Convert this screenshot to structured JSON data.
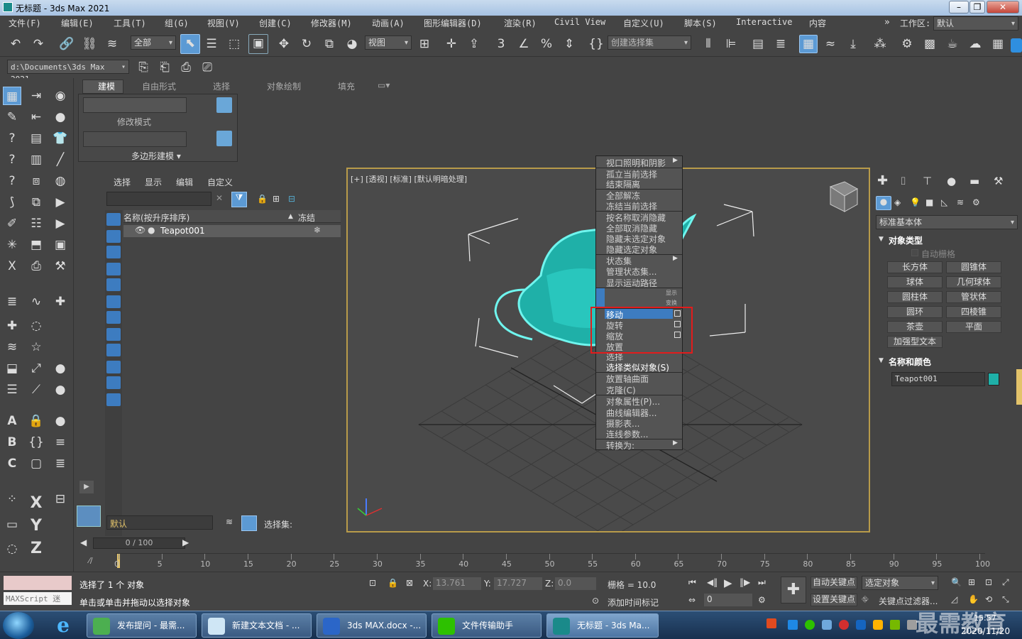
{
  "window": {
    "title": "无标题 - 3ds Max 2021",
    "buttons": [
      "–",
      "❐",
      "✕"
    ]
  },
  "menubar": {
    "items": [
      "文件(F)",
      "编辑(E)",
      "工具(T)",
      "组(G)",
      "视图(V)",
      "创建(C)",
      "修改器(M)",
      "动画(A)",
      "图形编辑器(D)",
      "渲染(R)",
      "Civil View",
      "自定义(U)",
      "脚本(S)",
      "Interactive",
      "内容"
    ],
    "workspace_label": "工作区:",
    "workspace_value": "默认"
  },
  "toolbar": {
    "filter_value": "全部",
    "refcoord_value": "视图",
    "selection_set_placeholder": "创建选择集",
    "path_value": "d:\\Documents\\3ds Max 2021"
  },
  "ribbon": {
    "tabs": [
      "建模",
      "自由形式",
      "选择",
      "对象绘制",
      "填充"
    ],
    "modify_mode": "修改模式",
    "poly_modeling": "多边形建模 ▾"
  },
  "scene_explorer": {
    "tabs": [
      "选择",
      "显示",
      "编辑",
      "自定义"
    ],
    "col_name": "名称(按升序排序)",
    "col_sort_arrow": "▲",
    "col_freeze": "冻结",
    "rows": [
      {
        "name": "Teapot001",
        "freeze_icon": "❄"
      }
    ],
    "layer_value": "默认",
    "selection_set_label": "选择集:"
  },
  "viewport": {
    "label": "[+] [透视] [标准] [默认明暗处理]",
    "accent": "#2ec7c0",
    "border_color": "#b89b4a"
  },
  "context_menu": {
    "top_items": [
      {
        "label": "视口照明和阴影",
        "arrow": "▶"
      },
      {
        "label": "孤立当前选择"
      },
      {
        "label": "结束隔离"
      },
      {
        "label": "全部解冻"
      },
      {
        "label": "冻结当前选择"
      },
      {
        "label": "按名称取消隐藏"
      },
      {
        "label": "全部取消隐藏"
      },
      {
        "label": "隐藏未选定对象"
      },
      {
        "label": "隐藏选定对象"
      },
      {
        "label": "状态集",
        "arrow": "▶"
      },
      {
        "label": "管理状态集..."
      },
      {
        "label": "显示运动路径"
      }
    ],
    "quad_labels": [
      "显示",
      "变换"
    ],
    "transform_items": [
      "移动",
      "旋转",
      "缩放",
      "放置"
    ],
    "bottom_items": [
      {
        "label": "选择"
      },
      {
        "label": "选择类似对象(S)"
      },
      {
        "label": "放置轴曲面"
      },
      {
        "label": "克隆(C)"
      },
      {
        "label": "对象属性(P)..."
      },
      {
        "label": "曲线编辑器..."
      },
      {
        "label": "摄影表..."
      },
      {
        "label": "连线参数..."
      },
      {
        "label": "转换为:",
        "arrow": "▶"
      }
    ]
  },
  "command_panel": {
    "category": "标准基本体",
    "object_type_title": "对象类型",
    "autogrid": "自动栅格",
    "buttons": [
      "长方体",
      "圆锥体",
      "球体",
      "几何球体",
      "圆柱体",
      "管状体",
      "圆环",
      "四棱锥",
      "茶壶",
      "平面",
      "加强型文本"
    ],
    "name_color_title": "名称和颜色",
    "object_name": "Teapot001",
    "object_color": "#1fb0a8"
  },
  "timeline": {
    "frame_display": "0 / 100",
    "ticks": [
      "0",
      "5",
      "10",
      "15",
      "20",
      "25",
      "30",
      "35",
      "40",
      "45",
      "50",
      "55",
      "60",
      "65",
      "70",
      "75",
      "80",
      "85",
      "90",
      "95",
      "100"
    ]
  },
  "status": {
    "maxscript": "MAXScript 迷",
    "selected": "选择了 1 个 对象",
    "prompt": "单击或单击并拖动以选择对象",
    "x_label": "X:",
    "x_value": "13.761",
    "y_label": "Y:",
    "y_value": "17.727",
    "z_label": "Z:",
    "z_value": "0.0",
    "grid": "栅格 = 10.0",
    "add_time_tag": "添加时间标记",
    "auto_key": "自动关键点",
    "selected_object": "选定对象",
    "set_key": "设置关键点",
    "key_filters": "关键点过滤器...",
    "frame_value": "0"
  },
  "taskbar": {
    "tasks": [
      "发布提问 - 最需...",
      "新建文本文档 - ...",
      "3ds MAX.docx -...",
      "文件传输助手",
      "无标题 - 3ds Ma..."
    ],
    "date": "2020/11/20",
    "time": "15:57",
    "watermark": "最需教育"
  }
}
